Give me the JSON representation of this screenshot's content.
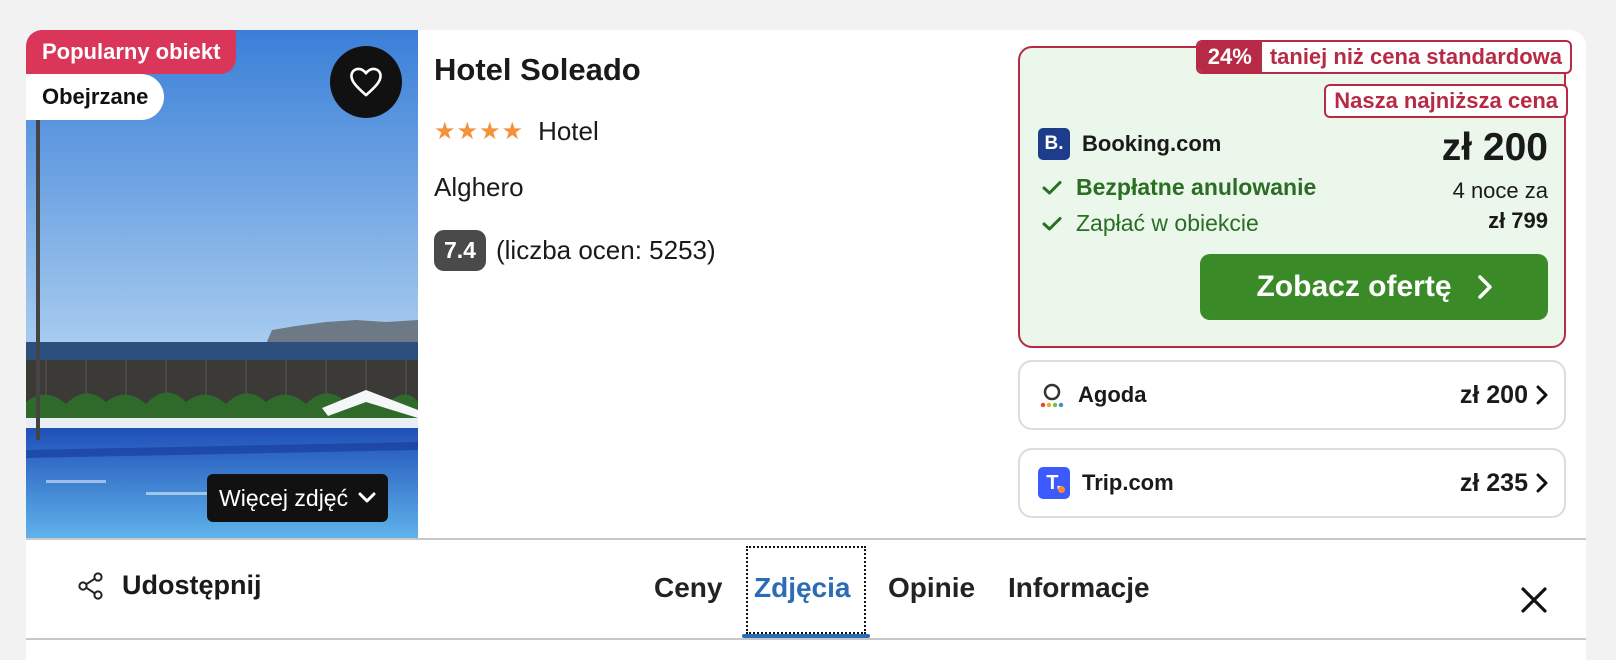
{
  "photo": {
    "badge_popular": "Popularny obiekt",
    "badge_seen": "Obejrzane",
    "more_photos": "Więcej zdjęć"
  },
  "hotel": {
    "name": "Hotel Soleado",
    "stars": "★★★★",
    "type": "Hotel",
    "city": "Alghero",
    "score": "7.4",
    "reviews": "(liczba ocen: 5253)"
  },
  "main_offer": {
    "discount_pct": "24%",
    "discount_text": "taniej niż cena standardowa",
    "lowest": "Nasza najniższa cena",
    "provider_logo": "B.",
    "provider": "Booking.com",
    "price": "zł 200",
    "nights": "4 noce za",
    "total": "zł 799",
    "feature_1": "Bezpłatne anulowanie",
    "feature_2": "Zapłać w obiekcie",
    "cta": "Zobacz ofertę"
  },
  "alt_offers": [
    {
      "provider": "Agoda",
      "price": "zł 200"
    },
    {
      "provider": "Trip.com",
      "price": "zł 235",
      "logo": "T."
    }
  ],
  "nav": {
    "share": "Udostępnij",
    "tabs": [
      "Ceny",
      "Zdjęcia",
      "Opinie",
      "Informacje"
    ],
    "active_tab": "Zdjęcia"
  },
  "colors": {
    "accent_green": "#3a8a28",
    "deal_red": "#b72a45",
    "popular_pink": "#d9365a",
    "active_blue": "#2a6db5",
    "star_orange": "#f3923b"
  }
}
